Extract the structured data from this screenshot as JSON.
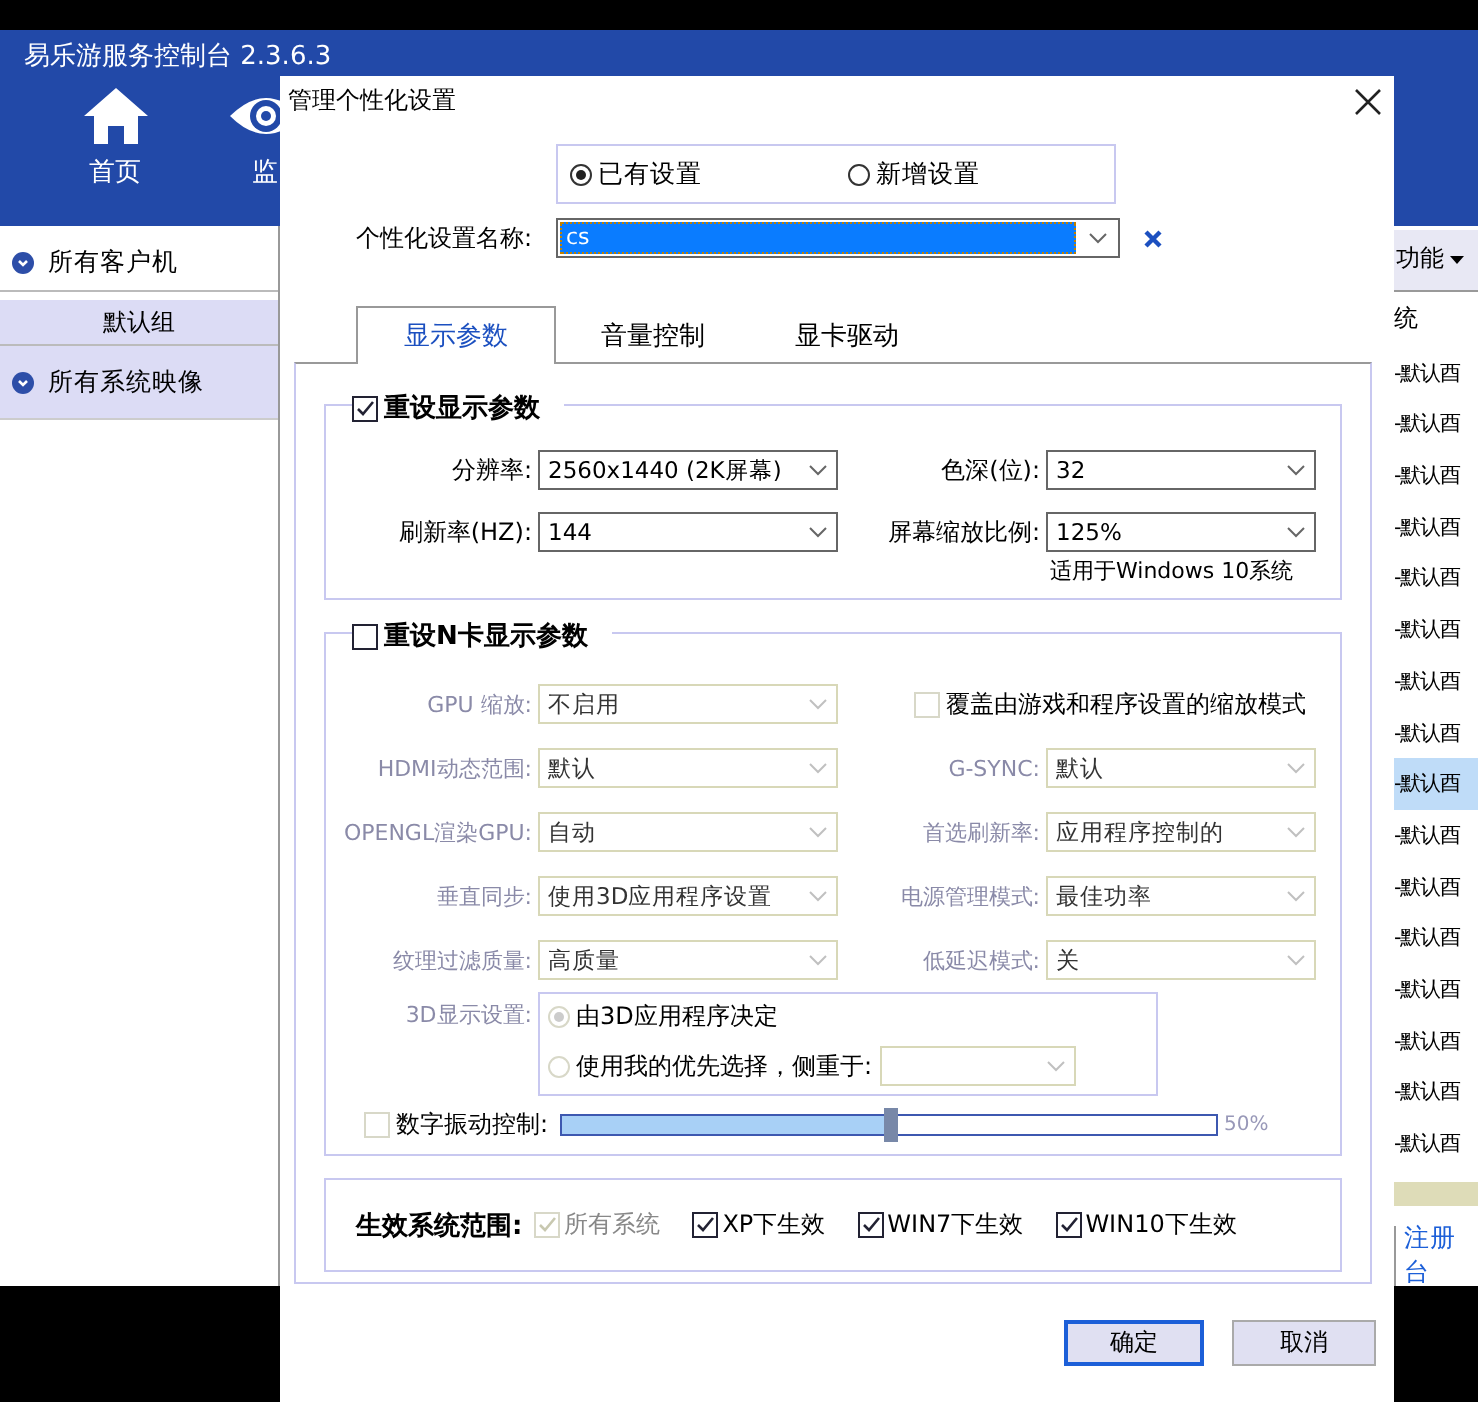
{
  "app": {
    "title": "易乐游服务控制台 2.3.6.3",
    "nav": [
      {
        "label": "首页",
        "kind": "home"
      },
      {
        "label": "监",
        "kind": "eye"
      }
    ],
    "sidebar": [
      {
        "label": "所有客户机",
        "kind": "section"
      },
      {
        "label": "默认组",
        "kind": "group"
      },
      {
        "label": "所有系统映像",
        "kind": "section"
      }
    ],
    "toolbar_menu": "功能",
    "column_header": "统",
    "rows": [
      {
        "text": "-默认酉",
        "selected": false
      },
      {
        "text": "-默认酉",
        "selected": false
      },
      {
        "text": "-默认酉",
        "selected": false
      },
      {
        "text": "-默认酉",
        "selected": false
      },
      {
        "text": "-默认酉",
        "selected": false
      },
      {
        "text": "-默认酉",
        "selected": false
      },
      {
        "text": "-默认酉",
        "selected": false
      },
      {
        "text": "-默认酉",
        "selected": false
      },
      {
        "text": "-默认酉",
        "selected": true
      },
      {
        "text": "-默认酉",
        "selected": false
      },
      {
        "text": "-默认酉",
        "selected": false
      },
      {
        "text": "-默认酉",
        "selected": false
      },
      {
        "text": "-默认酉",
        "selected": false
      },
      {
        "text": "-默认酉",
        "selected": false
      },
      {
        "text": "-默认酉",
        "selected": false
      },
      {
        "text": "-默认酉",
        "selected": false
      }
    ],
    "footer_link": "注册台"
  },
  "dialog": {
    "title": "管理个性化设置",
    "modes": [
      {
        "label": "已有设置",
        "selected": true
      },
      {
        "label": "新增设置",
        "selected": false
      }
    ],
    "name_label": "个性化设置名称:",
    "name_value": "cs",
    "tabs": [
      {
        "label": "显示参数",
        "selected": true
      },
      {
        "label": "音量控制",
        "selected": false
      },
      {
        "label": "显卡驱动",
        "selected": false
      }
    ],
    "display": {
      "title": "重设显示参数",
      "checked": true,
      "fields": [
        {
          "label": "分辨率:",
          "value": "2560x1440 (2K屏幕)"
        },
        {
          "label": "色深(位):",
          "value": "32"
        },
        {
          "label": "刷新率(HZ):",
          "value": "144"
        },
        {
          "label": "屏幕缩放比例:",
          "value": "125%"
        }
      ],
      "note": "适用于Windows 10系统"
    },
    "nvidia": {
      "title": "重设N卡显示参数",
      "checked": false,
      "disabled": true,
      "gpu_scaling": {
        "label": "GPU 缩放:",
        "value": "不启用"
      },
      "override": {
        "label": "覆盖由游戏和程序设置的缩放模式",
        "checked": false
      },
      "fields": [
        {
          "label": "HDMI动态范围:",
          "value": "默认"
        },
        {
          "label": "G-SYNC:",
          "value": "默认"
        },
        {
          "label": "OPENGL渲染GPU:",
          "value": "自动"
        },
        {
          "label": "首选刷新率:",
          "value": "应用程序控制的"
        },
        {
          "label": "垂直同步:",
          "value": "使用3D应用程序设置"
        },
        {
          "label": "电源管理模式:",
          "value": "最佳功率"
        },
        {
          "label": "纹理过滤质量:",
          "value": "高质量"
        },
        {
          "label": "低延迟模式:",
          "value": "关"
        }
      ],
      "d3_label": "3D显示设置:",
      "d3_options": [
        {
          "label": "由3D应用程序决定",
          "selected": true
        },
        {
          "label": "使用我的优先选择，侧重于:",
          "selected": false
        }
      ],
      "vibrance": {
        "label": "数字振动控制:",
        "checked": false,
        "level": 0.5,
        "reading": "50%"
      }
    },
    "scope": {
      "label": "生效系统范围:",
      "options": [
        {
          "label": "所有系统",
          "checked": true,
          "disabled": true
        },
        {
          "label": "XP下生效",
          "checked": true,
          "disabled": false
        },
        {
          "label": "WIN7下生效",
          "checked": true,
          "disabled": false
        },
        {
          "label": "WIN10下生效",
          "checked": true,
          "disabled": false
        }
      ]
    },
    "buttons": [
      {
        "label": "确定",
        "kind": "primary"
      },
      {
        "label": "取消",
        "kind": "normal"
      }
    ]
  }
}
